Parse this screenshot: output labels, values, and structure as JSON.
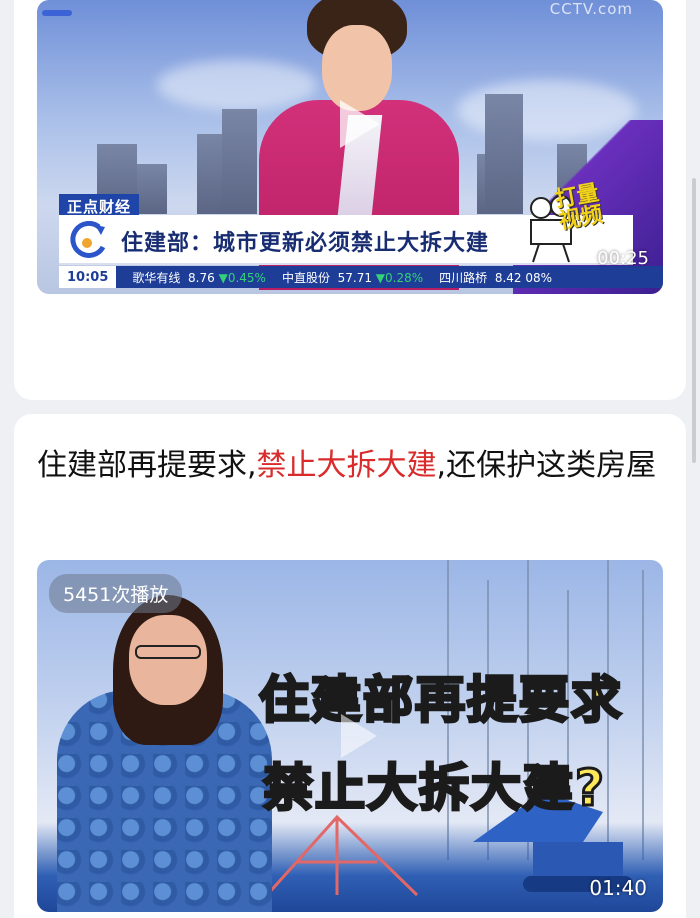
{
  "feed": {
    "item1": {
      "top_watermark": "CCTV.com",
      "tag": "正点财经",
      "headline": "住建部：城市更新必须禁止大拆大建",
      "overlay_text": "打量\n视频",
      "ticker": {
        "time": "10:05",
        "items": [
          {
            "name": "歌华有线",
            "price": "8.76",
            "change": "▼0.45%"
          },
          {
            "name": "中直股份",
            "price": "57.71",
            "change": "▼0.28%"
          },
          {
            "name": "四川路桥",
            "price": "8.42",
            "change": "08%"
          }
        ]
      },
      "duration": "00:25"
    },
    "item2": {
      "title_part1": "住建部再提要求,",
      "title_highlight": "禁止大拆大建",
      "title_part2": ",还保护这类房屋",
      "play_count": "5451次播放",
      "thumb_line1": "住建部再提要求",
      "thumb_line2": "禁止大拆大建?",
      "duration": "01:40"
    }
  },
  "colors": {
    "highlight": "#d92b2b",
    "accent_blue": "#1d3d97",
    "thumb_text": "#fde85a"
  },
  "icons": [
    "play-icon",
    "news-logo-icon",
    "film-reel-icon"
  ]
}
